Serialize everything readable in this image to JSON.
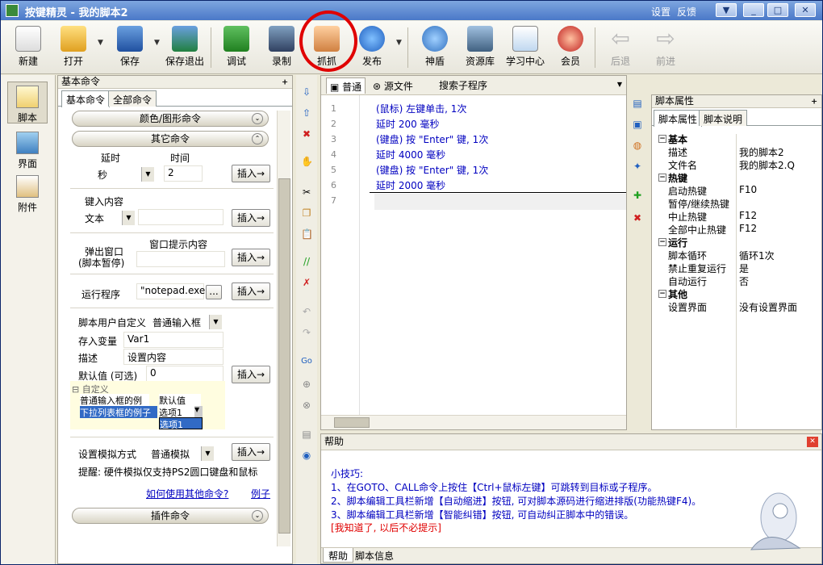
{
  "window": {
    "title": "按键精灵 - 我的脚本2",
    "settings": "设置",
    "feedback": "反馈"
  },
  "toolbar": {
    "items": [
      "新建",
      "打开",
      "保存",
      "保存退出",
      "调试",
      "录制",
      "抓抓",
      "发布",
      "神盾",
      "资源库",
      "学习中心",
      "会员",
      "后退",
      "前进"
    ]
  },
  "leftnav": {
    "items": [
      "脚本",
      "界面",
      "附件"
    ]
  },
  "leftpanel": {
    "header": "基本命令",
    "tabs": [
      "基本命令",
      "全部命令"
    ],
    "group_color": "颜色/图形命令",
    "group_other": "其它命令",
    "group_plugin": "插件命令",
    "delay_label": "延时",
    "time_label": "时间",
    "delay_unit": "秒",
    "delay_value": "2",
    "insert": "插入→",
    "keyin_label": "键入内容",
    "keyin_type": "文本",
    "popup_line1": "弹出窗口",
    "popup_line2": "(脚本暂停)",
    "popup_content_label": "窗口提示内容",
    "run_label": "运行程序",
    "run_value": "\"notepad.exe\"",
    "run_browse": "...",
    "custom_label": "脚本用户自定义",
    "custom_type": "普通输入框",
    "var_label": "存入变量",
    "var_value": "Var1",
    "desc_label": "描述",
    "desc_value": "设置内容",
    "default_label": "默认值 (可选)",
    "default_value": "0",
    "cus_title": "自定义",
    "cus_row1_k": "普通输入框的例子",
    "cus_row1_v": "默认值",
    "cus_row2_k": "下拉列表框的例子",
    "cus_row2_v": "选项1",
    "cus_row3_v": "选项1",
    "sim_label": "设置模拟方式",
    "sim_value": "普通模拟",
    "tip": "提醒: 硬件模拟仅支持PS2圆口键盘和鼠标",
    "howto": "如何使用其他命令?",
    "example": "例子"
  },
  "editor": {
    "tabs": [
      "普通",
      "源文件"
    ],
    "search": "搜索子程序",
    "line_numbers": [
      "1",
      "2",
      "3",
      "4",
      "5",
      "6",
      "7"
    ],
    "lines": [
      "(鼠标) 左键单击, 1次",
      "延时 200 毫秒",
      "(键盘) 按 \"Enter\" 键, 1次",
      "延时 4000 毫秒",
      "(键盘) 按 \"Enter\" 键, 1次",
      "延时 2000 毫秒",
      ""
    ]
  },
  "props": {
    "header": "脚本属性",
    "tabs": [
      "脚本属性",
      "脚本说明"
    ],
    "rows": [
      {
        "g": true,
        "k": "基本"
      },
      {
        "k": "描述",
        "v": "我的脚本2"
      },
      {
        "k": "文件名",
        "v": "我的脚本2.Q"
      },
      {
        "g": true,
        "k": "热键"
      },
      {
        "k": "启动热键",
        "v": "F10"
      },
      {
        "k": "暂停/继续热键",
        "v": ""
      },
      {
        "k": "中止热键",
        "v": "F12"
      },
      {
        "k": "全部中止热键",
        "v": "F12"
      },
      {
        "g": true,
        "k": "运行"
      },
      {
        "k": "脚本循环",
        "v": "循环1次"
      },
      {
        "k": "禁止重复运行",
        "v": "是"
      },
      {
        "k": "自动运行",
        "v": "否"
      },
      {
        "g": true,
        "k": "其他"
      },
      {
        "k": "设置界面",
        "v": "没有设置界面"
      }
    ]
  },
  "help": {
    "header": "帮助",
    "lines": [
      "小技巧:",
      "1、在GOTO、CALL命令上按住【Ctrl+鼠标左键】可跳转到目标或子程序。",
      "2、脚本编辑工具栏新增【自动缩进】按钮, 可对脚本源码进行缩进排版(功能热键F4)。",
      "3、脚本编辑工具栏新增【智能纠错】按钮, 可自动纠正脚本中的错误。"
    ],
    "dismiss": "[我知道了, 以后不必提示]",
    "tabs": [
      "帮助",
      "脚本信息"
    ]
  },
  "colors": {
    "accent": "#0000c0",
    "highlight": "#e00000"
  }
}
